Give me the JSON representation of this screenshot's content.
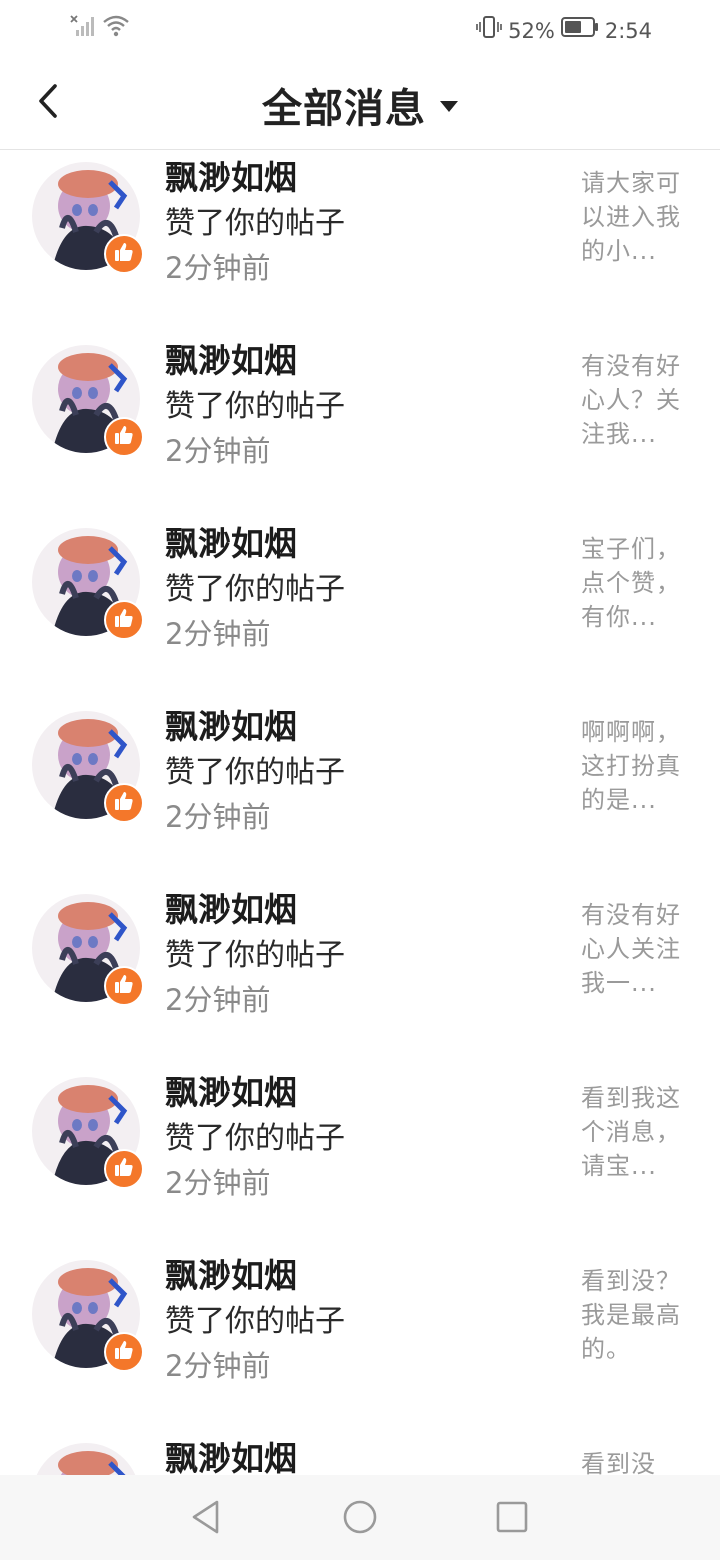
{
  "status_bar": {
    "icons": [
      "signal-off-icon",
      "wifi-icon"
    ],
    "right_icons": [
      "vibrate-icon",
      "battery-icon"
    ],
    "battery": "52%",
    "time": "2:54"
  },
  "header": {
    "title": "全部消息",
    "back_icon": "chevron-left-icon",
    "dropdown_icon": "caret-down-icon"
  },
  "messages": [
    {
      "name": "飘渺如烟",
      "action": "赞了你的帖子",
      "time": "2分钟前",
      "preview": "请大家可以进入我的小..."
    },
    {
      "name": "飘渺如烟",
      "action": "赞了你的帖子",
      "time": "2分钟前",
      "preview": "有没有好心人？关注我..."
    },
    {
      "name": "飘渺如烟",
      "action": "赞了你的帖子",
      "time": "2分钟前",
      "preview": "宝子们，点个赞，有你..."
    },
    {
      "name": "飘渺如烟",
      "action": "赞了你的帖子",
      "time": "2分钟前",
      "preview": "啊啊啊，这打扮真的是..."
    },
    {
      "name": "飘渺如烟",
      "action": "赞了你的帖子",
      "time": "2分钟前",
      "preview": "有没有好心人关注我一..."
    },
    {
      "name": "飘渺如烟",
      "action": "赞了你的帖子",
      "time": "2分钟前",
      "preview": "看到我这个消息，请宝..."
    },
    {
      "name": "飘渺如烟",
      "action": "赞了你的帖子",
      "time": "2分钟前",
      "preview": "看到没？我是最高的。"
    },
    {
      "name": "飘渺如烟",
      "action": "",
      "time": "",
      "preview": "看到没"
    }
  ],
  "nav_bar": {
    "icons": [
      "back-triangle-icon",
      "home-circle-icon",
      "recents-square-icon"
    ]
  },
  "colors": {
    "like_badge": "#f4772a",
    "secondary_text": "#8a8a8a",
    "preview_text": "#9a9a9a",
    "nav_background": "#f7f7f7"
  }
}
